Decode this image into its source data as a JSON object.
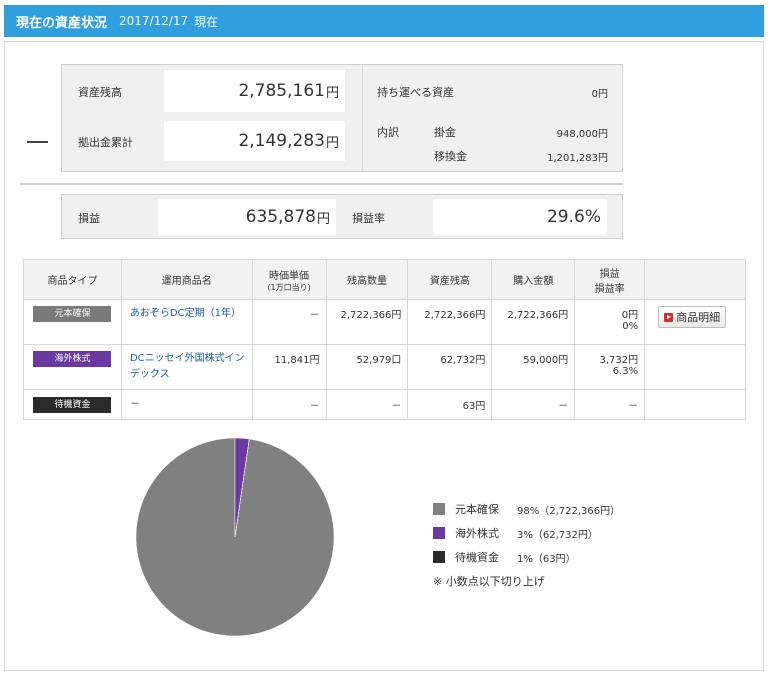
{
  "header": {
    "title": "現在の資産状況",
    "date": "2017/12/17",
    "date_suffix": "現在"
  },
  "summary": {
    "balance_label": "資産残高",
    "balance_value": "2,785,161",
    "balance_unit": "円",
    "contrib_label": "拠出金累計",
    "contrib_value": "2,149,283",
    "contrib_unit": "円",
    "portable_label": "持ち運べる資産",
    "portable_value": "0円",
    "breakdown_label": "内訳",
    "kakekin_label": "掛金",
    "kakekin_value": "948,000円",
    "ikan_label": "移換金",
    "ikan_value": "1,201,283円",
    "collapse_symbol": "—"
  },
  "profit": {
    "label": "損益",
    "value": "635,878",
    "unit": "円",
    "rate_label": "損益率",
    "rate_value": "29.6%"
  },
  "table": {
    "headers": {
      "type": "商品タイプ",
      "name": "運用商品名",
      "price": "時価単価",
      "price_sub": "(1万口当り)",
      "qty": "残高数量",
      "balance": "資産残高",
      "purchase": "購入金額",
      "pl": "損益",
      "pl_rate": "損益率"
    },
    "rows": [
      {
        "type": "元本確保",
        "type_color": "#7a7a7a",
        "name": "あおぞらDC定期（1年）",
        "price": "－",
        "qty": "2,722,366円",
        "balance": "2,722,366円",
        "purchase": "2,722,366円",
        "pl": "0円",
        "pl_rate": "0%",
        "action": "商品明細"
      },
      {
        "type": "海外株式",
        "type_color": "#6a3aa0",
        "name": "DCニッセイ外国株式インデックス",
        "price": "11,841円",
        "qty": "52,979口",
        "balance": "62,732円",
        "purchase": "59,000円",
        "pl": "3,732円",
        "pl_rate": "6.3%"
      },
      {
        "type": "待機資金",
        "type_color": "#2b2b2b",
        "name": "－",
        "price": "－",
        "qty": "－",
        "balance": "63円",
        "purchase": "－",
        "pl": "－"
      }
    ]
  },
  "pie": {
    "colors": [
      "#808080",
      "#6a3aa0",
      "#2b2b2b"
    ],
    "shares_percent": [
      97.7,
      2.3,
      0.002
    ]
  },
  "legend": {
    "items": [
      {
        "label": "元本確保",
        "pct": "98%（2,722,366円）",
        "color": "#808080"
      },
      {
        "label": "海外株式",
        "pct": "3%（62,732円）",
        "color": "#6a3aa0"
      },
      {
        "label": "待機資金",
        "pct": "1%（63円）",
        "color": "#2b2b2b"
      }
    ],
    "note": "※ 小数点以下切り上げ"
  }
}
